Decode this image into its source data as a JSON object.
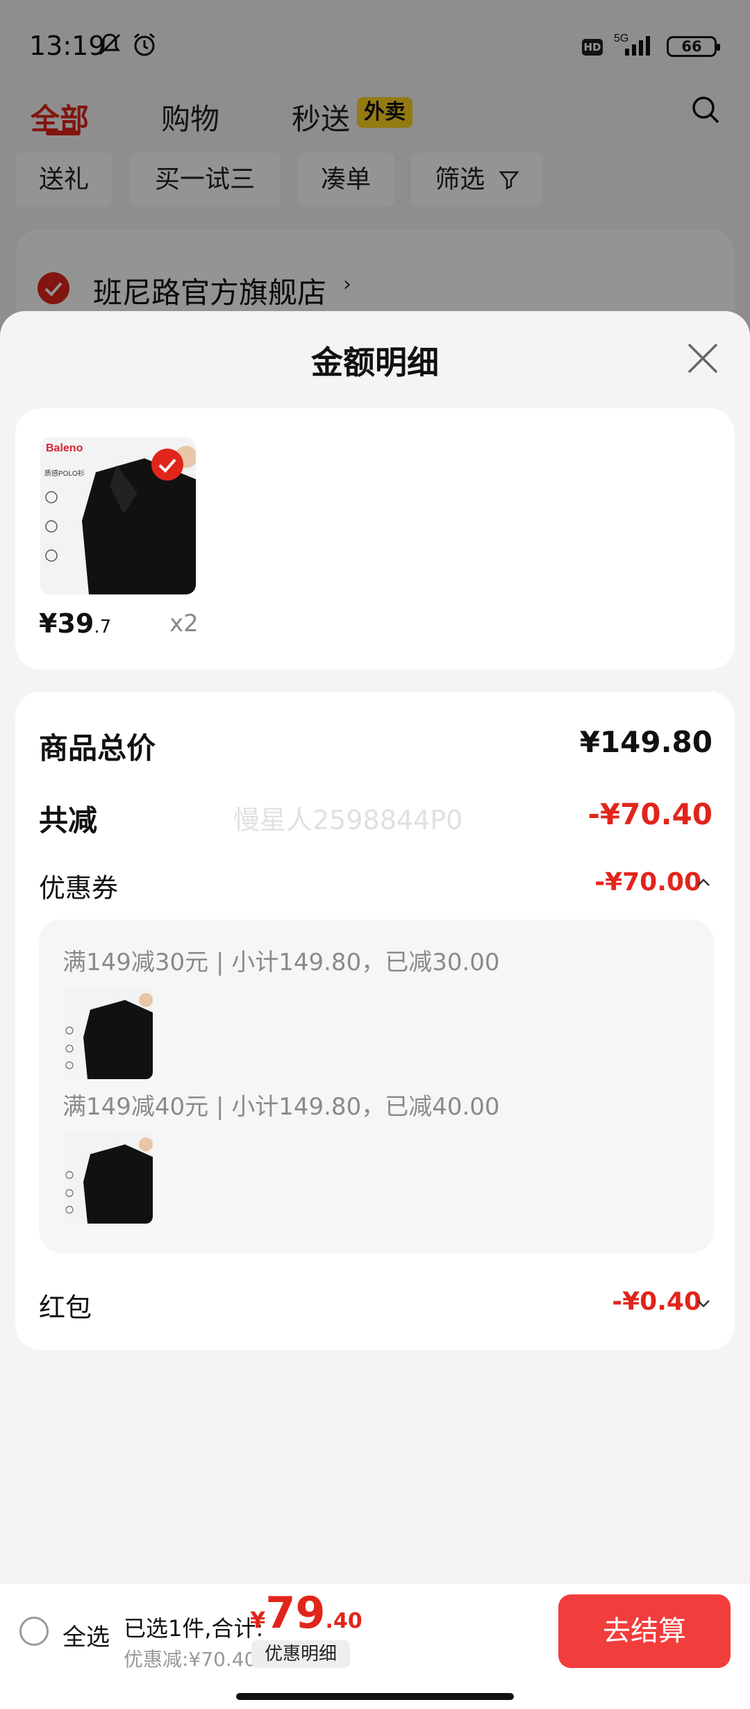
{
  "status_bar": {
    "time": "13:19",
    "hd": "HD",
    "network": "5G",
    "battery": "66"
  },
  "top_tabs": [
    {
      "label": "全部"
    },
    {
      "label": "购物"
    },
    {
      "label": "秒送"
    }
  ],
  "waimai_badge": "外卖",
  "filter_chips": [
    "送礼",
    "买一试三",
    "凑单",
    "筛选"
  ],
  "store": {
    "name": "班尼路官方旗舰店"
  },
  "sheet": {
    "title": "金额明细",
    "product": {
      "brand": "Baleno",
      "img_caption": "质感POLO衫",
      "price_int": "¥39",
      "price_dec": ".7",
      "qty": "x2"
    },
    "total_label": "商品总价",
    "total_value": "¥149.80",
    "discount_label": "共减",
    "discount_value": "-¥70.40",
    "watermark": "慢星人2598844P0",
    "coupon_label": "优惠券",
    "coupon_value": "-¥70.00",
    "coupons": [
      {
        "text": "满149减30元 | 小计149.80，已减30.00"
      },
      {
        "text": "满149减40元 | 小计149.80，已减40.00"
      }
    ],
    "redpacket_label": "红包",
    "redpacket_value": "-¥0.40"
  },
  "bottom_bar": {
    "select_all": "全选",
    "summary": "已选1件,合计:",
    "currency": "¥",
    "total_int": "79",
    "total_dec": ".40",
    "saved": "优惠减:¥70.40",
    "detail_button": "优惠明细",
    "checkout_button": "去结算"
  },
  "colors": {
    "accent": "#e1251b",
    "checkout": "#f23d3d",
    "badge": "#ffd320"
  }
}
